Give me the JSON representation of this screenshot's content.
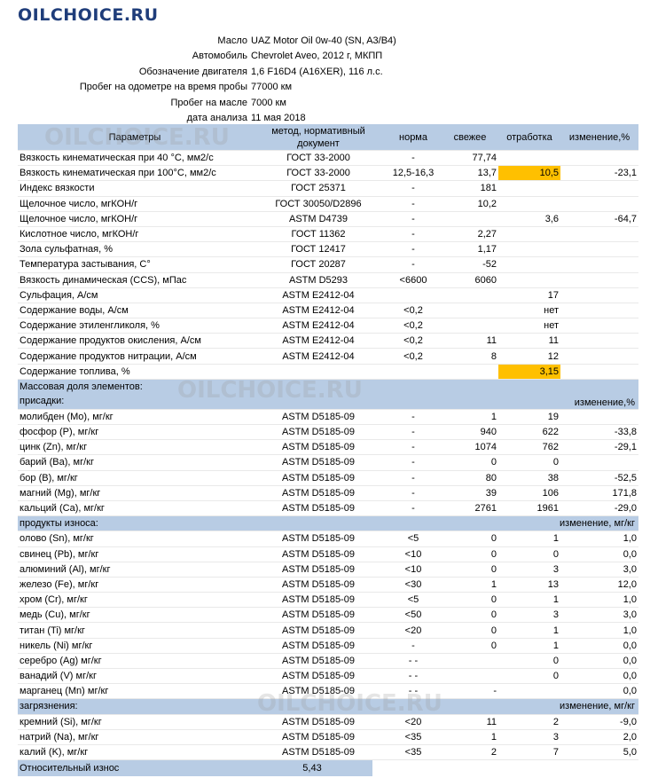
{
  "logo": "OILCHOICE.RU",
  "watermark": "OILCHOICE.RU",
  "meta": [
    {
      "label": "Масло",
      "value": "UAZ Motor Oil 0w-40 (SN, A3/B4)"
    },
    {
      "label": "Автомобиль",
      "value": "Chevrolet Aveo, 2012 г, МКПП"
    },
    {
      "label": "Обозначение двигателя",
      "value": "1,6 F16D4 (A16XER), 116 л.с."
    },
    {
      "label": "Пробег на одометре на время пробы",
      "value": "77000 км"
    },
    {
      "label": "Пробег на масле",
      "value": "7000 км"
    },
    {
      "label": "дата анализа",
      "value": "11 мая 2018"
    }
  ],
  "headers": {
    "param": "Параметры",
    "method": "метод, нормативный документ",
    "norm": "норма",
    "fresh": "свежее",
    "used": "отработка",
    "change": "изменение,%"
  },
  "rows_main": [
    {
      "param": "Вязкость кинематическая при 40 °С, мм2/с",
      "method": "ГОСТ 33-2000",
      "norm": "-",
      "fresh": "77,74",
      "used": "",
      "change": ""
    },
    {
      "param": "Вязкость кинематическая при 100°С, мм2/с",
      "method": "ГОСТ 33-2000",
      "norm": "12,5-16,3",
      "fresh": "13,7",
      "used": "10,5",
      "change": "-23,1"
    },
    {
      "param": "Индекс вязкости",
      "method": "ГОСТ 25371",
      "norm": "-",
      "fresh": "181",
      "used": "",
      "change": ""
    },
    {
      "param": "Щелочное число, мгКОН/г",
      "method": "ГОСТ 30050/D2896",
      "norm": "-",
      "fresh": "10,2",
      "used": "",
      "change": ""
    },
    {
      "param": "Щелочное число, мгКОН/г",
      "method": "ASTM D4739",
      "norm": "-",
      "fresh": "",
      "used": "3,6",
      "change": "-64,7"
    },
    {
      "param": "Кислотное число, мгКОН/г",
      "method": "ГОСТ 11362",
      "norm": "-",
      "fresh": "2,27",
      "used": "",
      "change": ""
    },
    {
      "param": "Зола сульфатная, %",
      "method": "ГОСТ 12417",
      "norm": "-",
      "fresh": "1,17",
      "used": "",
      "change": ""
    },
    {
      "param": "Температура застывания, С°",
      "method": "ГОСТ 20287",
      "norm": "-",
      "fresh": "-52",
      "used": "",
      "change": ""
    },
    {
      "param": "Вязкость динамическая (CCS), мПас",
      "method": "ASTM D5293",
      "norm": "<6600",
      "fresh": "6060",
      "used": "",
      "change": ""
    },
    {
      "param": "Сульфация, A/см",
      "method": "ASTM E2412-04",
      "norm": "",
      "fresh": "",
      "used": "17",
      "change": ""
    },
    {
      "param": "Содержание воды, A/см",
      "method": "ASTM E2412-04",
      "norm": "<0,2",
      "fresh": "",
      "used": "нет",
      "change": ""
    },
    {
      "param": "Содержание этиленгликоля, %",
      "method": "ASTM E2412-04",
      "norm": "<0,2",
      "fresh": "",
      "used": "нет",
      "change": ""
    },
    {
      "param": "Содержание продуктов окисления, A/см",
      "method": "ASTM E2412-04",
      "norm": "<0,2",
      "fresh": "11",
      "used": "11",
      "change": ""
    },
    {
      "param": "Содержание продуктов нитрации, A/см",
      "method": "ASTM E2412-04",
      "norm": "<0,2",
      "fresh": "8",
      "used": "12",
      "change": ""
    },
    {
      "param": "Содержание топлива, %",
      "method": "",
      "norm": "",
      "fresh": "",
      "used": "3,15",
      "change": ""
    }
  ],
  "section_additives": {
    "line1": "Массовая доля элементов:",
    "line2": "присадки:",
    "right": "изменение,%"
  },
  "rows_additives": [
    {
      "param": "молибден (Mo), мг/кг",
      "method": "ASTM D5185-09",
      "norm": "-",
      "fresh": "1",
      "used": "19",
      "change": ""
    },
    {
      "param": "фосфор (P), мг/кг",
      "method": "ASTM D5185-09",
      "norm": "-",
      "fresh": "940",
      "used": "622",
      "change": "-33,8"
    },
    {
      "param": "цинк (Zn), мг/кг",
      "method": "ASTM D5185-09",
      "norm": "-",
      "fresh": "1074",
      "used": "762",
      "change": "-29,1"
    },
    {
      "param": "барий (Ba), мг/кг",
      "method": "ASTM D5185-09",
      "norm": "-",
      "fresh": "0",
      "used": "0",
      "change": ""
    },
    {
      "param": "бор (B), мг/кг",
      "method": "ASTM D5185-09",
      "norm": "-",
      "fresh": "80",
      "used": "38",
      "change": "-52,5"
    },
    {
      "param": "магний (Mg), мг/кг",
      "method": "ASTM D5185-09",
      "norm": "-",
      "fresh": "39",
      "used": "106",
      "change": "171,8"
    },
    {
      "param": "кальций (Ca), мг/кг",
      "method": "ASTM D5185-09",
      "norm": "-",
      "fresh": "2761",
      "used": "1961",
      "change": "-29,0"
    }
  ],
  "section_wear": {
    "label": "продукты износа:",
    "right": "изменение, мг/кг"
  },
  "rows_wear": [
    {
      "param": "олово (Sn), мг/кг",
      "method": "ASTM D5185-09",
      "norm": "<5",
      "fresh": "0",
      "used": "1",
      "change": "1,0"
    },
    {
      "param": "свинец (Pb), мг/кг",
      "method": "ASTM D5185-09",
      "norm": "<10",
      "fresh": "0",
      "used": "0",
      "change": "0,0"
    },
    {
      "param": "алюминий (Al), мг/кг",
      "method": "ASTM D5185-09",
      "norm": "<10",
      "fresh": "0",
      "used": "3",
      "change": "3,0"
    },
    {
      "param": "железо (Fe), мг/кг",
      "method": "ASTM D5185-09",
      "norm": "<30",
      "fresh": "1",
      "used": "13",
      "change": "12,0"
    },
    {
      "param": "хром (Cr), мг/кг",
      "method": "ASTM D5185-09",
      "norm": "<5",
      "fresh": "0",
      "used": "1",
      "change": "1,0"
    },
    {
      "param": "медь (Cu), мг/кг",
      "method": "ASTM D5185-09",
      "norm": "<50",
      "fresh": "0",
      "used": "3",
      "change": "3,0"
    },
    {
      "param": "титан (Ti) мг/кг",
      "method": "ASTM D5185-09",
      "norm": "<20",
      "fresh": "0",
      "used": "1",
      "change": "1,0"
    },
    {
      "param": "никель (Ni) мг/кг",
      "method": "ASTM D5185-09",
      "norm": "-",
      "fresh": "0",
      "used": "1",
      "change": "0,0"
    },
    {
      "param": "серебро (Ag) мг/кг",
      "method": "ASTM D5185-09",
      "norm": "-      -",
      "fresh": "",
      "used": "0",
      "change": "0,0"
    },
    {
      "param": "ванадий (V) мг/кг",
      "method": "ASTM D5185-09",
      "norm": "-      -",
      "fresh": "",
      "used": "0",
      "change": "0,0"
    },
    {
      "param": "марганец (Mn) мг/кг",
      "method": "ASTM D5185-09",
      "norm": "-      -",
      "fresh": "-",
      "used": "",
      "change": "0,0"
    }
  ],
  "section_pollution": {
    "label": "загрязнения:",
    "right": "изменение, мг/кг"
  },
  "rows_pollution": [
    {
      "param": "кремний (Si), мг/кг",
      "method": "ASTM D5185-09",
      "norm": "<20",
      "fresh": "11",
      "used": "2",
      "change": "-9,0"
    },
    {
      "param": "натрий (Na), мг/кг",
      "method": "ASTM D5185-09",
      "norm": "<35",
      "fresh": "1",
      "used": "3",
      "change": "2,0"
    },
    {
      "param": "калий (K), мг/кг",
      "method": "ASTM D5185-09",
      "norm": "<35",
      "fresh": "2",
      "used": "7",
      "change": "5,0"
    }
  ],
  "wear_index": {
    "label": "Относительный износ",
    "value": "5,43"
  },
  "highlight_color": "#ffc000",
  "header_color": "#b8cce4"
}
